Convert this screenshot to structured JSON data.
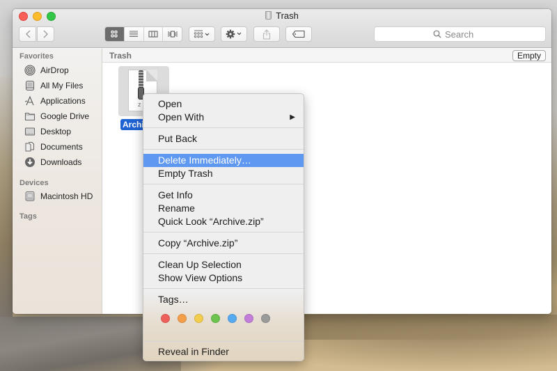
{
  "window": {
    "title": "Trash",
    "traffic_lights": [
      {
        "name": "close",
        "color": "#fc5f57"
      },
      {
        "name": "minimize",
        "color": "#fdbc2e"
      },
      {
        "name": "zoom",
        "color": "#33c748"
      }
    ]
  },
  "toolbar": {
    "back_icon": "chevron-left-icon",
    "forward_icon": "chevron-right-icon",
    "view_modes": [
      {
        "name": "icon-view",
        "active": true
      },
      {
        "name": "list-view",
        "active": false
      },
      {
        "name": "column-view",
        "active": false
      },
      {
        "name": "cover-flow-view",
        "active": false
      }
    ],
    "arrange_icon": "arrange-grid-icon",
    "action_icon": "gear-icon",
    "share_icon": "share-icon",
    "tag_icon": "tag-icon",
    "search_placeholder": "Search"
  },
  "sidebar": {
    "sections": [
      {
        "title": "Favorites",
        "items": [
          {
            "label": "AirDrop",
            "icon": "airdrop-icon"
          },
          {
            "label": "All My Files",
            "icon": "all-my-files-icon"
          },
          {
            "label": "Applications",
            "icon": "applications-icon"
          },
          {
            "label": "Google Drive",
            "icon": "folder-icon"
          },
          {
            "label": "Desktop",
            "icon": "desktop-icon"
          },
          {
            "label": "Documents",
            "icon": "documents-icon"
          },
          {
            "label": "Downloads",
            "icon": "downloads-icon"
          }
        ]
      },
      {
        "title": "Devices",
        "items": [
          {
            "label": "Macintosh HD",
            "icon": "hard-drive-icon"
          }
        ]
      },
      {
        "title": "Tags",
        "items": []
      }
    ]
  },
  "content": {
    "path_title": "Trash",
    "empty_button": "Empty",
    "files": [
      {
        "name": "Archive.zip",
        "label_visible": "Archi",
        "ext_visible": "z",
        "selected": true
      }
    ]
  },
  "context_menu": {
    "groups": [
      [
        {
          "label": "Open"
        },
        {
          "label": "Open With",
          "submenu": true,
          "arrow": "▶"
        }
      ],
      [
        {
          "label": "Put Back"
        }
      ],
      [
        {
          "label": "Delete Immediately…",
          "highlighted": true
        },
        {
          "label": "Empty Trash"
        }
      ],
      [
        {
          "label": "Get Info"
        },
        {
          "label": "Rename"
        },
        {
          "label": "Quick Look “Archive.zip”"
        }
      ],
      [
        {
          "label": "Copy “Archive.zip”"
        }
      ],
      [
        {
          "label": "Clean Up Selection"
        },
        {
          "label": "Show View Options"
        }
      ],
      [
        {
          "label": "Tags…"
        }
      ],
      [
        {
          "label": "Reveal in Finder"
        }
      ]
    ],
    "tag_colors": [
      {
        "name": "red",
        "color": "#f0605a"
      },
      {
        "name": "orange",
        "color": "#f59e4a"
      },
      {
        "name": "yellow",
        "color": "#f3cd4e"
      },
      {
        "name": "green",
        "color": "#6cc44f"
      },
      {
        "name": "blue",
        "color": "#56aaf2"
      },
      {
        "name": "purple",
        "color": "#c27ed9"
      },
      {
        "name": "gray",
        "color": "#9a9a9a"
      }
    ]
  }
}
